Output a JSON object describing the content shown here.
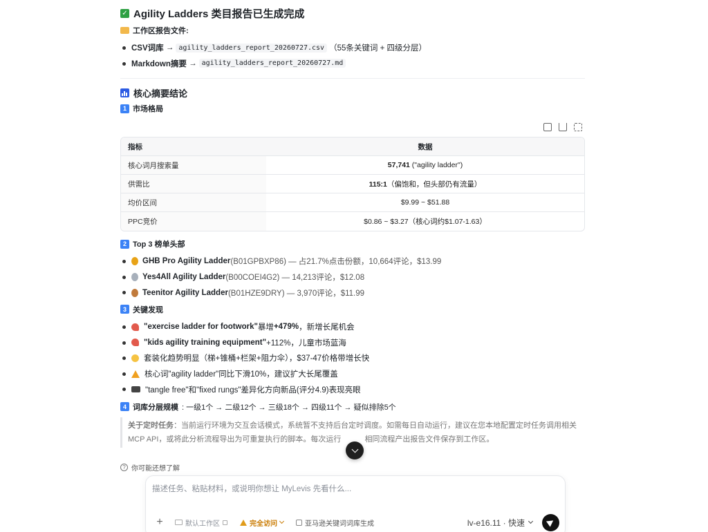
{
  "report": {
    "title": "Agility Ladders 类目报告已生成完成",
    "files_heading": "工作区报告文件:",
    "files": [
      {
        "label": "CSV词库",
        "arrow": "→",
        "filename": "agility_ladders_report_20260727.csv",
        "note": "（55条关键词 + 四级分层）"
      },
      {
        "label": "Markdown摘要",
        "arrow": "→",
        "filename": "agility_ladders_report_20260727.md",
        "note": ""
      }
    ],
    "summary_heading": "核心摘要结论"
  },
  "sections": {
    "market": {
      "num": "1",
      "title": "市场格局"
    },
    "top3": {
      "num": "2",
      "title": "Top 3 榜单头部"
    },
    "findings": {
      "num": "3",
      "title": "关键发现"
    },
    "tiers": {
      "num": "4",
      "title": "词库分层规模",
      "text": ": 一级1个 → 二级12个 → 三级18个 → 四级11个 → 疑似排除5个"
    }
  },
  "market_table": {
    "headers": [
      "指标",
      "数据"
    ],
    "rows": [
      {
        "metric": "核心词月搜索量",
        "bold": "57,741",
        "rest": " (\"agility ladder\")"
      },
      {
        "metric": "供需比",
        "bold": "115:1",
        "rest": "（偏饱和，但头部仍有流量）"
      },
      {
        "metric": "均价区间",
        "bold": "",
        "rest": "$9.99 ~ $51.88"
      },
      {
        "metric": "PPC竞价",
        "bold": "",
        "rest": "$0.86 ~ $3.27（核心词约$1.07-1.63）"
      }
    ]
  },
  "top3": [
    {
      "medal": "gold",
      "name": "GHB Pro Agility Ladder",
      "detail": " (B01GPBXP86) — 占21.7%点击份额，10,664评论，$13.99"
    },
    {
      "medal": "silver",
      "name": "Yes4All Agility Ladder",
      "detail": " (B00COEI4G2) — 14,213评论，$12.08"
    },
    {
      "medal": "bronze",
      "name": "Teenitor Agility Ladder",
      "detail": " (B01HZE9DRY) — 3,970评论，$11.99"
    }
  ],
  "findings": [
    {
      "icon": "rocket-icon",
      "bold": "\"exercise ladder for footwork\"",
      "mid": " 暴增 ",
      "bold2": "+479%",
      "rest": "，新增长尾机会"
    },
    {
      "icon": "rocket-icon",
      "bold": "\"kids agility training equipment\"",
      "mid": " +112%，儿童市场蓝海",
      "bold2": "",
      "rest": ""
    },
    {
      "icon": "bulb-icon",
      "bold": "",
      "mid": "套装化趋势明显（梯+锥桶+栏架+阻力伞），$37-47价格带增长快",
      "bold2": "",
      "rest": ""
    },
    {
      "icon": "warning-icon",
      "bold": "",
      "mid": "核心词\"agility ladder\"同比下滑10%，建议扩大长尾覆盖",
      "bold2": "",
      "rest": ""
    },
    {
      "icon": "new-icon",
      "bold": "",
      "mid": "\"tangle free\"和\"fixed rungs\"差异化方向新品(评分4.9)表现亮眼",
      "bold2": "",
      "rest": ""
    }
  ],
  "note": {
    "label": "关于定时任务",
    "text": "：当前运行环境为交互会话模式，系统暂不支持后台定时调度。如需每日自动运行，建议在您本地配置定时任务调用相关 MCP API，或将此分析流程导出为可重复执行的脚本。每次运行",
    "text_end": "相同流程产出报告文件保存到工作区。"
  },
  "suggest": "你可能还想了解",
  "composer": {
    "placeholder": "描述任务、粘贴材料，或说明你想让 MyLevis 先看什么...",
    "workspace": "默认工作区",
    "access": "完全访问",
    "skill": "亚马逊关键词词库生成",
    "model": "lv-e16.11 · 快速"
  }
}
